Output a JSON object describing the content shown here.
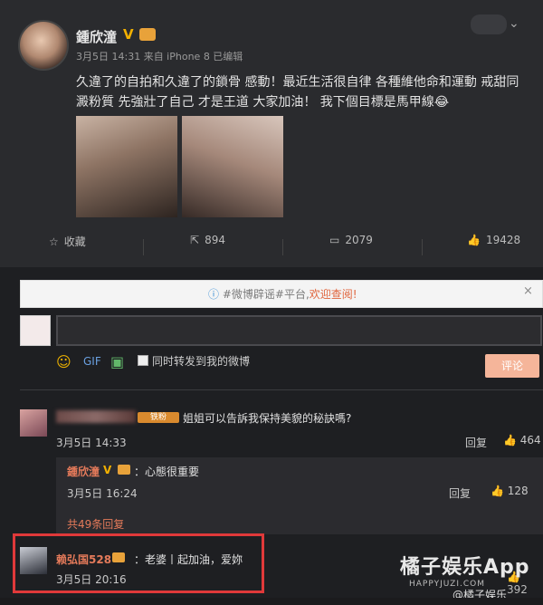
{
  "post": {
    "author": "鍾欣潼",
    "v_badge": "V",
    "meta": "3月5日 14:31 来自 iPhone 8   已编辑",
    "content": "久違了的自拍和久違了的鎖骨 感動！最近生活很自律 各種維他命和運動 戒甜同澱粉質 先強壯了自己 才是王道 大家加油！ 我下個目標是馬甲線😂",
    "chevron_icon": "chevron-down-icon"
  },
  "actions": {
    "collect": "收藏",
    "repost": "894",
    "comments": "2079",
    "likes": "19428"
  },
  "rumor_bar": {
    "prefix": "#微博辟谣#平台,",
    "link": "欢迎查阅!",
    "close": "×"
  },
  "composer": {
    "placeholder": "",
    "repost_label": "同时转发到我的微博",
    "submit_label": "评论"
  },
  "comment1": {
    "badge": "铁粉",
    "text": "姐姐可以告訴我保持美貌的秘訣嗎?",
    "time": "3月5日 14:33",
    "reply": "回复",
    "likes": "464"
  },
  "reply1": {
    "author": "鍾欣潼",
    "v_badge": "V",
    "text": "：心態很重要",
    "time": "3月5日 16:24",
    "reply": "回复",
    "likes": "128",
    "more": "共49条回复"
  },
  "comment2": {
    "author": "赖弘国528",
    "text": "：老婆丨起加油，爱妳",
    "time": "3月5日 20:16",
    "likes": "392"
  },
  "watermark": {
    "title": "橘子娱乐App",
    "url": "HAPPYJUZI.COM",
    "handle": "@橘子娱乐"
  }
}
